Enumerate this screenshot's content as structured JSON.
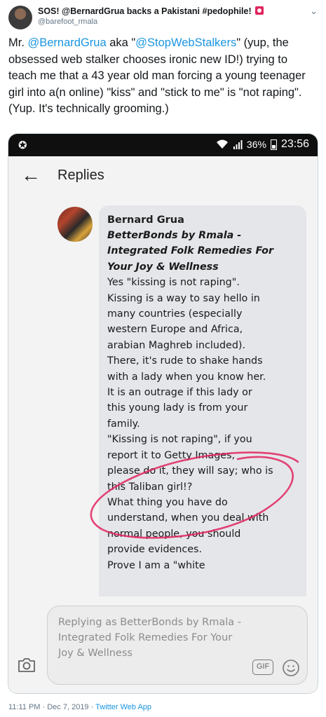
{
  "tweet": {
    "display_name": "SOS! @BernardGrua backs a Pakistani #pedophile!",
    "handle": "@barefoot_rmala",
    "text": {
      "before1": "Mr. ",
      "mention1": "@BernardGrua",
      "between": " aka \"",
      "mention2": "@StopWebStalkers",
      "after": "\" (yup, the obsessed web stalker chooses ironic new ID!) trying to teach me that a 43 year old man forcing a young teenager girl into a(n online) \"kiss\" and \"stick to me\" is \"not raping\". (Yup. It's technically grooming.)"
    },
    "time": "11:11 PM",
    "date": "Dec 7, 2019",
    "source": "Twitter Web App"
  },
  "phone": {
    "status": {
      "battery": "36%",
      "time": "23:56"
    },
    "appbar_title": "Replies",
    "comment": {
      "author": "Bernard Grua",
      "page_lines": [
        "BetterBonds by Rmala -",
        "Integrated Folk Remedies For",
        "Your Joy & Wellness"
      ],
      "lines": [
        "Yes \"kissing is not raping\".",
        "Kissing is a way to say hello in",
        "many countries (especially",
        "western Europe and Africa,",
        "arabian Maghreb included).",
        "There, it's rude to shake hands",
        "with a lady when you know her.",
        "It is an outrage if this lady or",
        "this young lady is from your",
        "family.",
        "\"Kissing is not raping\", if you",
        "report it to Getty Images,",
        "please do it, they will say; who is",
        "this Taliban girl!?",
        "What thing you have do",
        "understand, when you deal with",
        "normal people, you should",
        "provide evidences.",
        "Prove I am a \"white"
      ]
    },
    "reply_placeholder": "Replying as BetterBonds by Rmala - Integrated Folk Remedies For Your Joy & Wellness",
    "gif_label": "GIF",
    "accent_colors": {
      "link": "#1b95e0",
      "annotation": "#e0245e"
    }
  }
}
